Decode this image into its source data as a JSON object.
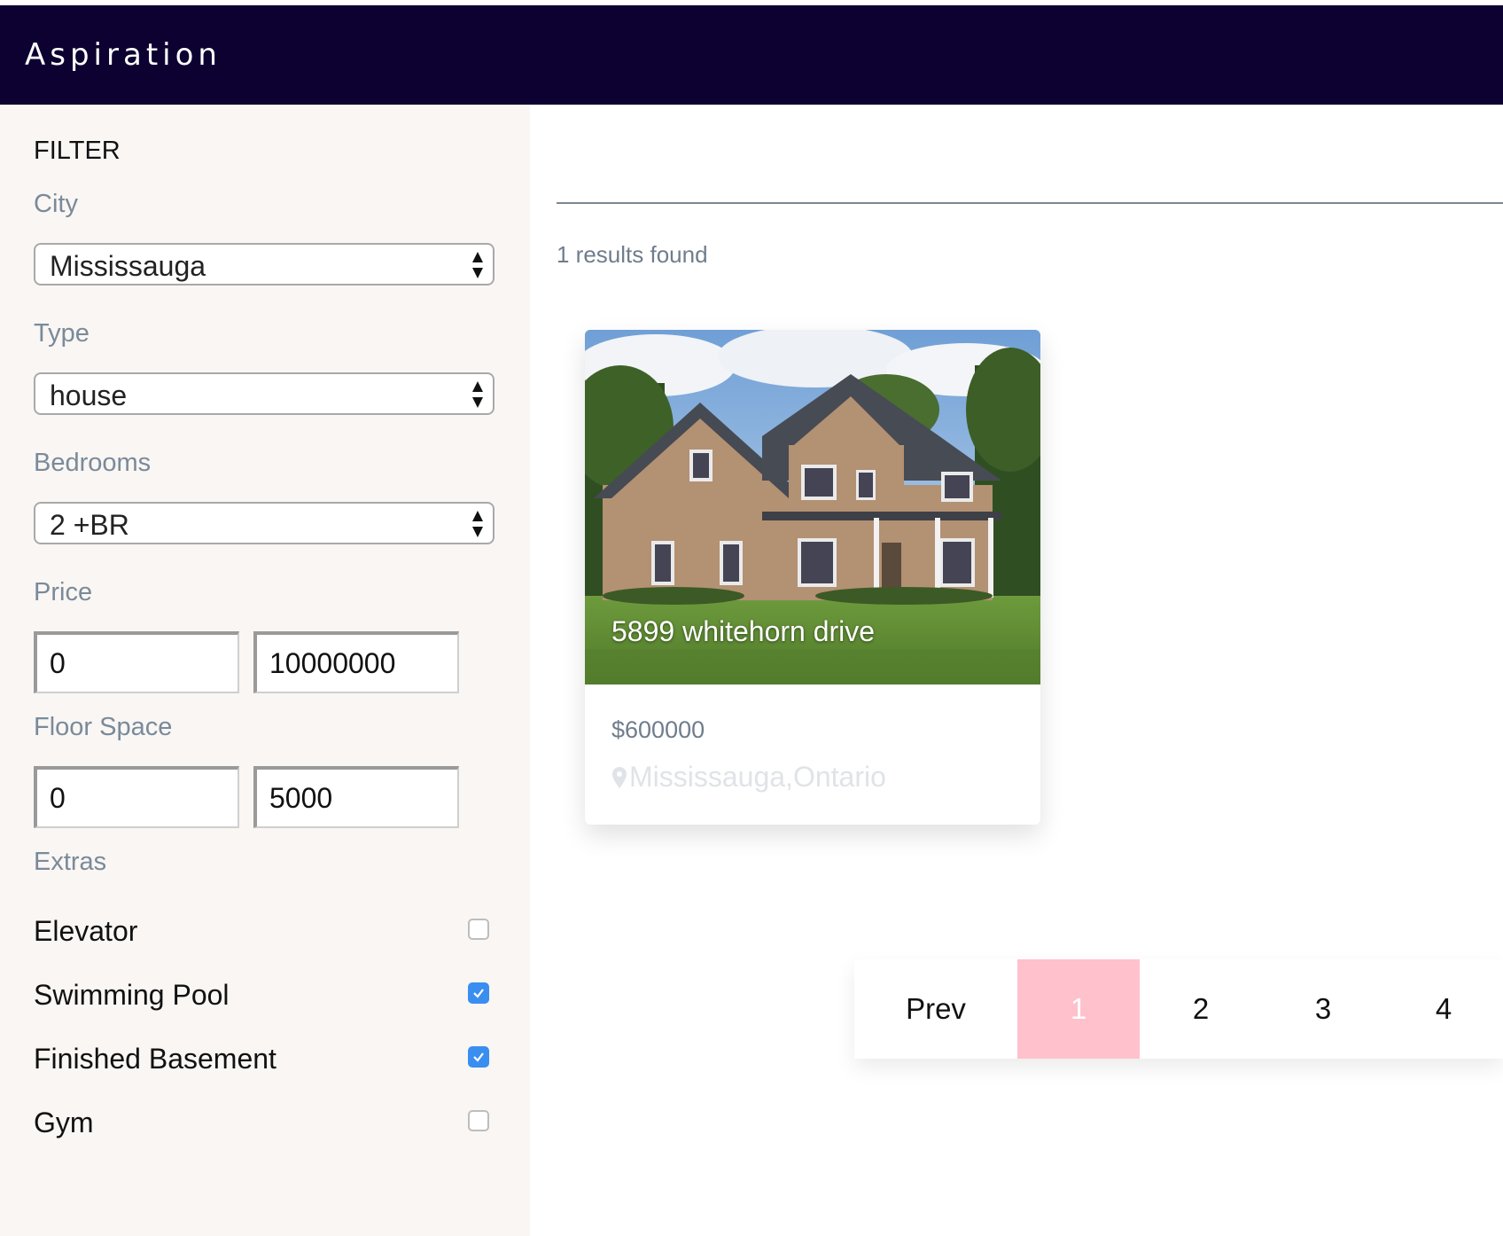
{
  "header": {
    "brand": "Aspiration"
  },
  "filter": {
    "title": "FILTER",
    "city": {
      "label": "City",
      "value": "Mississauga"
    },
    "type": {
      "label": "Type",
      "value": "house"
    },
    "bedrooms": {
      "label": "Bedrooms",
      "value": "2 +BR"
    },
    "price": {
      "label": "Price",
      "min": "0",
      "max": "10000000"
    },
    "floor_space": {
      "label": "Floor Space",
      "min": "0",
      "max": "5000"
    },
    "extras": {
      "label": "Extras",
      "items": [
        {
          "label": "Elevator",
          "checked": false
        },
        {
          "label": "Swimming Pool",
          "checked": true
        },
        {
          "label": "Finished Basement",
          "checked": true
        },
        {
          "label": "Gym",
          "checked": false
        }
      ]
    }
  },
  "results": {
    "text": "1 results found"
  },
  "listing": {
    "address": "5899 whitehorn drive",
    "price": "$600000",
    "location": "Mississauga,Ontario"
  },
  "pagination": {
    "prev": "Prev",
    "pages": [
      "1",
      "2",
      "3",
      "4"
    ],
    "active": "1"
  },
  "colors": {
    "header_bg": "#0c0130",
    "active_page": "#ffc1cb",
    "checkbox": "#3a8ef0"
  }
}
